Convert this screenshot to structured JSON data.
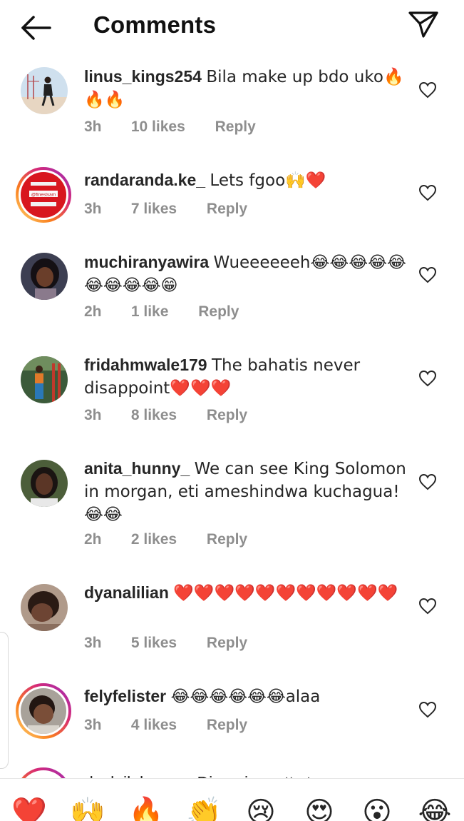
{
  "header": {
    "title": "Comments",
    "back_icon": "arrow-left-icon",
    "share_icon": "paper-plane-icon"
  },
  "comments": [
    {
      "username": "linus_kings254",
      "text": "Bila make up bdo uko🔥🔥🔥",
      "time": "3h",
      "likes": "10 likes",
      "reply": "Reply"
    },
    {
      "username": "randaranda.ke_",
      "text": "Lets fgoo🙌❤️",
      "time": "3h",
      "likes": "7 likes",
      "reply": "Reply",
      "avatar_text": "@finestsam"
    },
    {
      "username": "muchiranyawira",
      "text": "Wueeeeeeh😂😂😂😂😂😂😂😂😂😁",
      "time": "2h",
      "likes": "1 like",
      "reply": "Reply"
    },
    {
      "username": "fridahmwale179",
      "text": "The bahatis never disappoint❤️❤️❤️",
      "time": "3h",
      "likes": "8 likes",
      "reply": "Reply"
    },
    {
      "username": "anita_hunny_",
      "text": "We can see King Solomon in morgan, eti ameshindwa kuchagua! 😂😂",
      "time": "2h",
      "likes": "2 likes",
      "reply": "Reply"
    },
    {
      "username": "dyanalilian",
      "text": "❤️❤️❤️❤️❤️❤️❤️❤️❤️❤️❤️",
      "time": "3h",
      "likes": "5 likes",
      "reply": "Reply"
    },
    {
      "username": "felyfelister",
      "text": "😂😂😂😂😂😂alaa",
      "time": "3h",
      "likes": "4 likes",
      "reply": "Reply"
    }
  ],
  "partial_comment": {
    "text": "doslailahassan Diana is pretty too"
  },
  "reactions": [
    "❤️",
    "🙌",
    "🔥",
    "👏",
    "😢",
    "😍",
    "😮",
    "😂"
  ],
  "colors": {
    "text": "#262626",
    "meta": "#8e8e8e",
    "story_ring": "#d62976",
    "heart": "#e0152f"
  }
}
